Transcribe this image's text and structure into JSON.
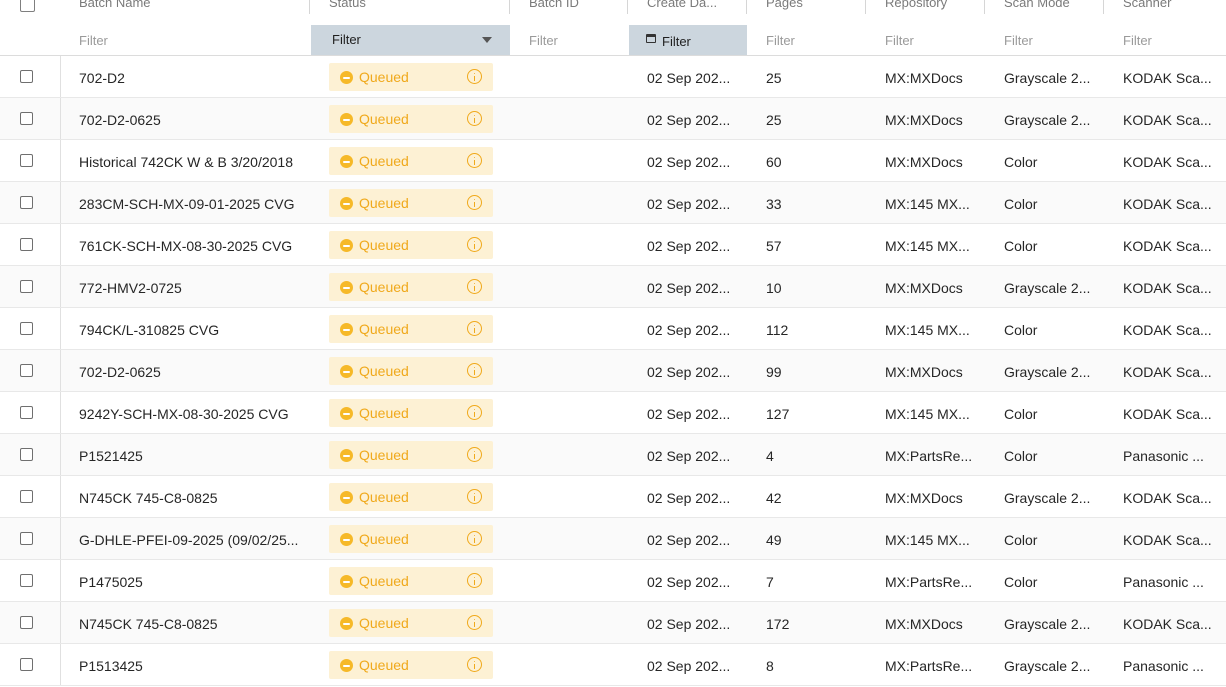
{
  "columns": [
    "",
    "Batch Name",
    "Status",
    "Batch ID",
    "Create Da...",
    "Pages",
    "Repository",
    "Scan Mode",
    "Scanner"
  ],
  "filters": {
    "batch_name": "Filter",
    "status": "Filter",
    "batch_id": "Filter",
    "create_date": "Filter",
    "pages": "Filter",
    "repository": "Filter",
    "scan_mode": "Filter",
    "scanner": "Filter"
  },
  "icons": {
    "status": "minus-circle-icon",
    "info": "info-circle-icon",
    "date_filter": "calendar-icon",
    "dropdown": "caret-down-icon"
  },
  "colors": {
    "queued_text": "#f0a91b",
    "queued_bg": "#fdf1d4",
    "active_filter_bg": "#ccd6de"
  },
  "rows": [
    {
      "batch_name": "702-D2",
      "status": "Queued",
      "batch_id": "",
      "create_date": "02 Sep 202...",
      "pages": "25",
      "repository": "MX:MXDocs",
      "scan_mode": "Grayscale 2...",
      "scanner": "KODAK Sca..."
    },
    {
      "batch_name": "702-D2-0625",
      "status": "Queued",
      "batch_id": "",
      "create_date": "02 Sep 202...",
      "pages": "25",
      "repository": "MX:MXDocs",
      "scan_mode": "Grayscale 2...",
      "scanner": "KODAK Sca..."
    },
    {
      "batch_name": "Historical 742CK W & B 3/20/2018",
      "status": "Queued",
      "batch_id": "",
      "create_date": "02 Sep 202...",
      "pages": "60",
      "repository": "MX:MXDocs",
      "scan_mode": "Color",
      "scanner": "KODAK Sca..."
    },
    {
      "batch_name": "283CM-SCH-MX-09-01-2025 CVG",
      "status": "Queued",
      "batch_id": "",
      "create_date": "02 Sep 202...",
      "pages": "33",
      "repository": "MX:145 MX...",
      "scan_mode": "Color",
      "scanner": "KODAK Sca..."
    },
    {
      "batch_name": "761CK-SCH-MX-08-30-2025 CVG",
      "status": "Queued",
      "batch_id": "",
      "create_date": "02 Sep 202...",
      "pages": "57",
      "repository": "MX:145 MX...",
      "scan_mode": "Color",
      "scanner": "KODAK Sca..."
    },
    {
      "batch_name": "772-HMV2-0725",
      "status": "Queued",
      "batch_id": "",
      "create_date": "02 Sep 202...",
      "pages": "10",
      "repository": "MX:MXDocs",
      "scan_mode": "Grayscale 2...",
      "scanner": "KODAK Sca..."
    },
    {
      "batch_name": "794CK/L-310825 CVG",
      "status": "Queued",
      "batch_id": "",
      "create_date": "02 Sep 202...",
      "pages": "112",
      "repository": "MX:145 MX...",
      "scan_mode": "Color",
      "scanner": "KODAK Sca..."
    },
    {
      "batch_name": "702-D2-0625",
      "status": "Queued",
      "batch_id": "",
      "create_date": "02 Sep 202...",
      "pages": "99",
      "repository": "MX:MXDocs",
      "scan_mode": "Grayscale 2...",
      "scanner": "KODAK Sca..."
    },
    {
      "batch_name": "9242Y-SCH-MX-08-30-2025 CVG",
      "status": "Queued",
      "batch_id": "",
      "create_date": "02 Sep 202...",
      "pages": "127",
      "repository": "MX:145 MX...",
      "scan_mode": "Color",
      "scanner": "KODAK Sca..."
    },
    {
      "batch_name": "P1521425",
      "status": "Queued",
      "batch_id": "",
      "create_date": "02 Sep 202...",
      "pages": "4",
      "repository": "MX:PartsRe...",
      "scan_mode": "Color",
      "scanner": "Panasonic ..."
    },
    {
      "batch_name": "N745CK 745-C8-0825",
      "status": "Queued",
      "batch_id": "",
      "create_date": "02 Sep 202...",
      "pages": "42",
      "repository": "MX:MXDocs",
      "scan_mode": "Grayscale 2...",
      "scanner": "KODAK Sca..."
    },
    {
      "batch_name": "G-DHLE-PFEI-09-2025 (09/02/25...",
      "status": "Queued",
      "batch_id": "",
      "create_date": "02 Sep 202...",
      "pages": "49",
      "repository": "MX:145 MX...",
      "scan_mode": "Color",
      "scanner": "KODAK Sca..."
    },
    {
      "batch_name": "P1475025",
      "status": "Queued",
      "batch_id": "",
      "create_date": "02 Sep 202...",
      "pages": "7",
      "repository": "MX:PartsRe...",
      "scan_mode": "Color",
      "scanner": "Panasonic ..."
    },
    {
      "batch_name": "N745CK 745-C8-0825",
      "status": "Queued",
      "batch_id": "",
      "create_date": "02 Sep 202...",
      "pages": "172",
      "repository": "MX:MXDocs",
      "scan_mode": "Grayscale 2...",
      "scanner": "KODAK Sca..."
    },
    {
      "batch_name": "P1513425",
      "status": "Queued",
      "batch_id": "",
      "create_date": "02 Sep 202...",
      "pages": "8",
      "repository": "MX:PartsRe...",
      "scan_mode": "Grayscale 2...",
      "scanner": "Panasonic ..."
    }
  ]
}
